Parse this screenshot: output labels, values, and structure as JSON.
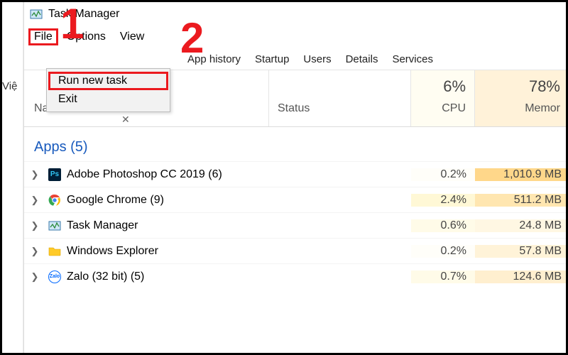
{
  "left_edge_text": "Việ",
  "title": "Task Manager",
  "menubar": {
    "file": "File",
    "options": "Options",
    "view": "View"
  },
  "dropdown": {
    "run_new_task": "Run new task",
    "exit": "Exit"
  },
  "tabs": {
    "app_history": "App history",
    "startup": "Startup",
    "users": "Users",
    "details": "Details",
    "services": "Services"
  },
  "columns": {
    "name": "Name",
    "status": "Status",
    "cpu_pct": "6%",
    "cpu_label": "CPU",
    "mem_pct": "78%",
    "mem_label": "Memor"
  },
  "group_apps": "Apps (5)",
  "processes": [
    {
      "name": "Adobe Photoshop CC 2019 (6)",
      "cpu": "0.2%",
      "mem": "1,010.9 MB",
      "icon": "ps"
    },
    {
      "name": "Google Chrome (9)",
      "cpu": "2.4%",
      "mem": "511.2 MB",
      "icon": "chrome"
    },
    {
      "name": "Task Manager",
      "cpu": "0.6%",
      "mem": "24.8 MB",
      "icon": "tm"
    },
    {
      "name": "Windows Explorer",
      "cpu": "0.2%",
      "mem": "57.8 MB",
      "icon": "explorer"
    },
    {
      "name": "Zalo (32 bit) (5)",
      "cpu": "0.7%",
      "mem": "124.6 MB",
      "icon": "zalo"
    }
  ],
  "annotations": {
    "one": "1",
    "two": "2"
  },
  "close_x": "✕"
}
